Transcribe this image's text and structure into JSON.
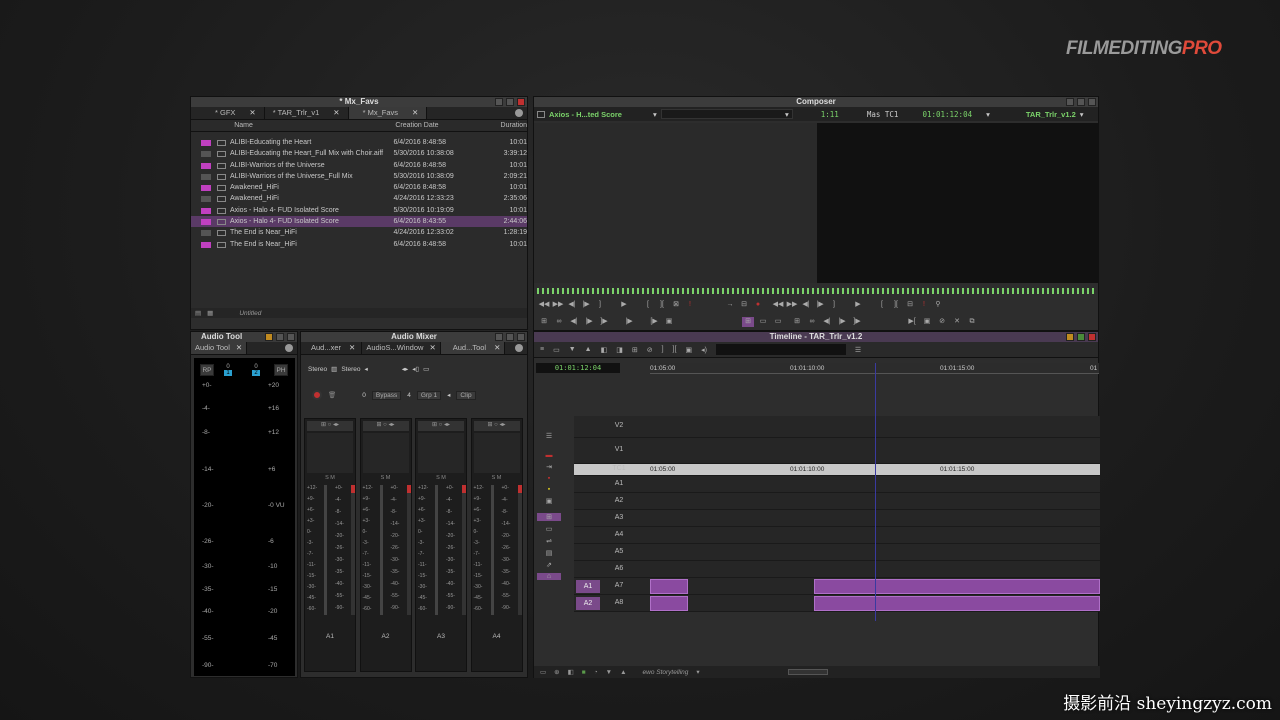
{
  "brand": {
    "part1": "FILM",
    "part2": "EDITING",
    "part3": "PRO"
  },
  "watermark": "摄影前沿 sheyingzyz.com",
  "bin": {
    "title": "* Mx_Favs",
    "tabs": [
      "* GFX",
      "* TAR_Trlr_v1",
      "* Mx_Favs"
    ],
    "columns": {
      "name": "Name",
      "date": "Creation Date",
      "duration": "Duration"
    },
    "rows": [
      {
        "name": "ALIBI-Educating the Heart",
        "date": "6/4/2016 8:48:58",
        "dur": "10:01",
        "color": "magenta"
      },
      {
        "name": "ALIBI-Educating the Heart_Full Mix with Choir.aiff",
        "date": "5/30/2016 10:38:08",
        "dur": "3:39:12",
        "color": "none"
      },
      {
        "name": "ALIBI-Warriors of the Universe",
        "date": "6/4/2016 8:48:58",
        "dur": "10:01",
        "color": "magenta"
      },
      {
        "name": "ALIBI-Warriors of the Universe_Full Mix",
        "date": "5/30/2016 10:38:09",
        "dur": "2:09:21",
        "color": "none"
      },
      {
        "name": "Awakened_HiFi",
        "date": "6/4/2016 8:48:58",
        "dur": "10:01",
        "color": "magenta"
      },
      {
        "name": "Awakened_HiFi",
        "date": "4/24/2016 12:33:23",
        "dur": "2:35:06",
        "color": "none"
      },
      {
        "name": "Axios - Halo 4- FUD Isolated Score",
        "date": "5/30/2016 10:19:09",
        "dur": "10:01",
        "color": "magenta"
      },
      {
        "name": "Axios - Halo 4- FUD Isolated Score",
        "date": "6/4/2016 8:43:55",
        "dur": "2:44:06",
        "color": "magenta",
        "selected": true
      },
      {
        "name": "The End is Near_HiFi",
        "date": "4/24/2016 12:33:02",
        "dur": "1:28:19",
        "color": "none"
      },
      {
        "name": "The End is Near_HiFi",
        "date": "6/4/2016 8:48:58",
        "dur": "10:01",
        "color": "magenta"
      }
    ],
    "footer": "Untitled"
  },
  "composer": {
    "title": "Composer",
    "clip_menu": "Axios - H...ted Score",
    "duration": "1:11",
    "tc_label": "Mas TC1",
    "tc_value": "01:01:12:04",
    "seq_menu": "TAR_Trlr_v1.2"
  },
  "audio_tool": {
    "title": "Audio Tool",
    "tab": "Audio Tool",
    "buttons": [
      "RP",
      "PH"
    ],
    "ch": [
      "1",
      "2"
    ],
    "left_scale": [
      "+0-",
      "-4-",
      "-8-",
      "-14-",
      "-20-",
      "-26-",
      "-30-",
      "-35-",
      "-40-",
      "-55-",
      "-90-"
    ],
    "right_scale": [
      "+20",
      "+16",
      "+12",
      "+6",
      "-0 VU",
      "-6",
      "-10",
      "-15",
      "-20",
      "-45",
      "-70"
    ]
  },
  "audio_mixer": {
    "title": "Audio Mixer",
    "tabs": [
      "Aud...xer",
      "AudioS...Window",
      "Aud...Tool"
    ],
    "stereo1": "Stereo",
    "stereo2": "Stereo",
    "bypass_num": "0",
    "bypass": "Bypass",
    "grp_num": "4",
    "grp": "Grp 1",
    "clip": "Clip",
    "channels": [
      "A1",
      "A2",
      "A3",
      "A4"
    ],
    "scale": [
      "+12-",
      "+9-",
      "+6-",
      "+3-",
      "0-",
      "-3-",
      "-7-",
      "-11-",
      "-15-",
      "-30-",
      "-45-",
      "-60-"
    ],
    "scale2": [
      "+0-",
      "-4-",
      "-8-",
      "-14-",
      "-20-",
      "-26-",
      "-30-",
      "-35-",
      "-40-",
      "-55-",
      "-90-"
    ]
  },
  "timeline": {
    "title": "Timeline - TAR_Trlr_v1.2",
    "tc": "01:01:12:04",
    "ruler": [
      "01:05:00",
      "01:01:10:00",
      "01:01:15:00",
      "01"
    ],
    "tracks": [
      "V2",
      "V1",
      "TC1",
      "A1",
      "A2",
      "A3",
      "A4",
      "A5",
      "A6",
      "A7",
      "A8"
    ],
    "src_tracks": [
      "A1",
      "A2"
    ],
    "footer": "ewo Storytelling"
  }
}
